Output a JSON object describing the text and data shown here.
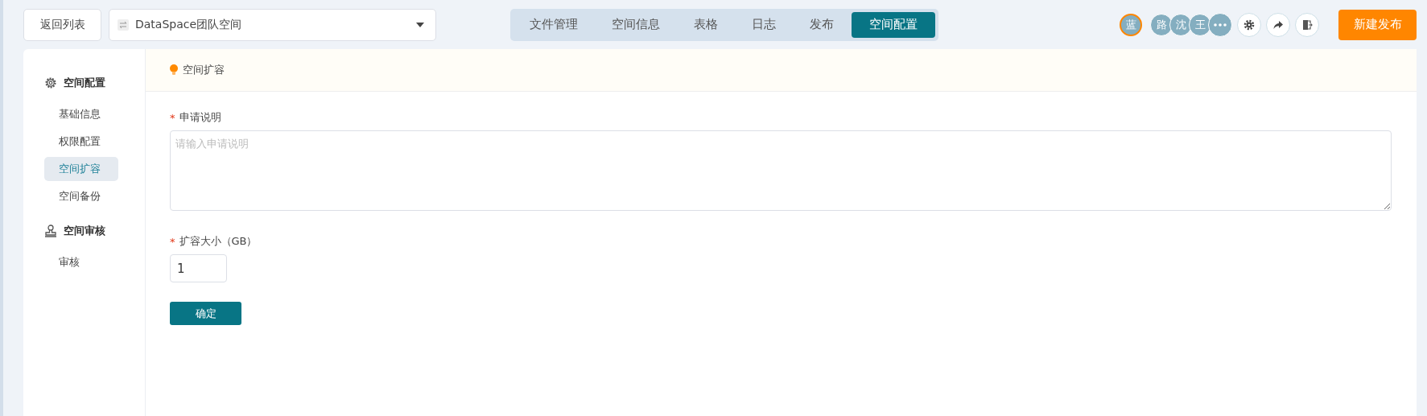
{
  "top_bar": {
    "back_button": "返回列表",
    "space_select": {
      "value": "DataSpace团队空间"
    },
    "tabs": [
      {
        "label": "文件管理",
        "selected": false
      },
      {
        "label": "空间信息",
        "selected": false
      },
      {
        "label": "表格",
        "selected": false
      },
      {
        "label": "日志",
        "selected": false
      },
      {
        "label": "发布",
        "selected": false
      },
      {
        "label": "空间配置",
        "selected": true
      }
    ],
    "owner_avatar": "蓝",
    "member_avatars": [
      "路",
      "沈",
      "王"
    ],
    "new_publish_button": "新建发布"
  },
  "sidebar": {
    "groups": [
      {
        "title": "空间配置",
        "kind": "settings",
        "items": [
          {
            "label": "基础信息",
            "selected": false
          },
          {
            "label": "权限配置",
            "selected": false
          },
          {
            "label": "空间扩容",
            "selected": true
          },
          {
            "label": "空间备份",
            "selected": false
          }
        ]
      },
      {
        "title": "空间审核",
        "kind": "review",
        "items": [
          {
            "label": "审核",
            "selected": false
          }
        ]
      }
    ]
  },
  "content": {
    "header": "空间扩容",
    "form": {
      "description": {
        "label": "申请说明",
        "required_mark": "*",
        "placeholder": "请输入申请说明"
      },
      "size": {
        "label": "扩容大小（GB）",
        "required_mark": "*",
        "value": "1"
      },
      "submit": "确定"
    }
  }
}
